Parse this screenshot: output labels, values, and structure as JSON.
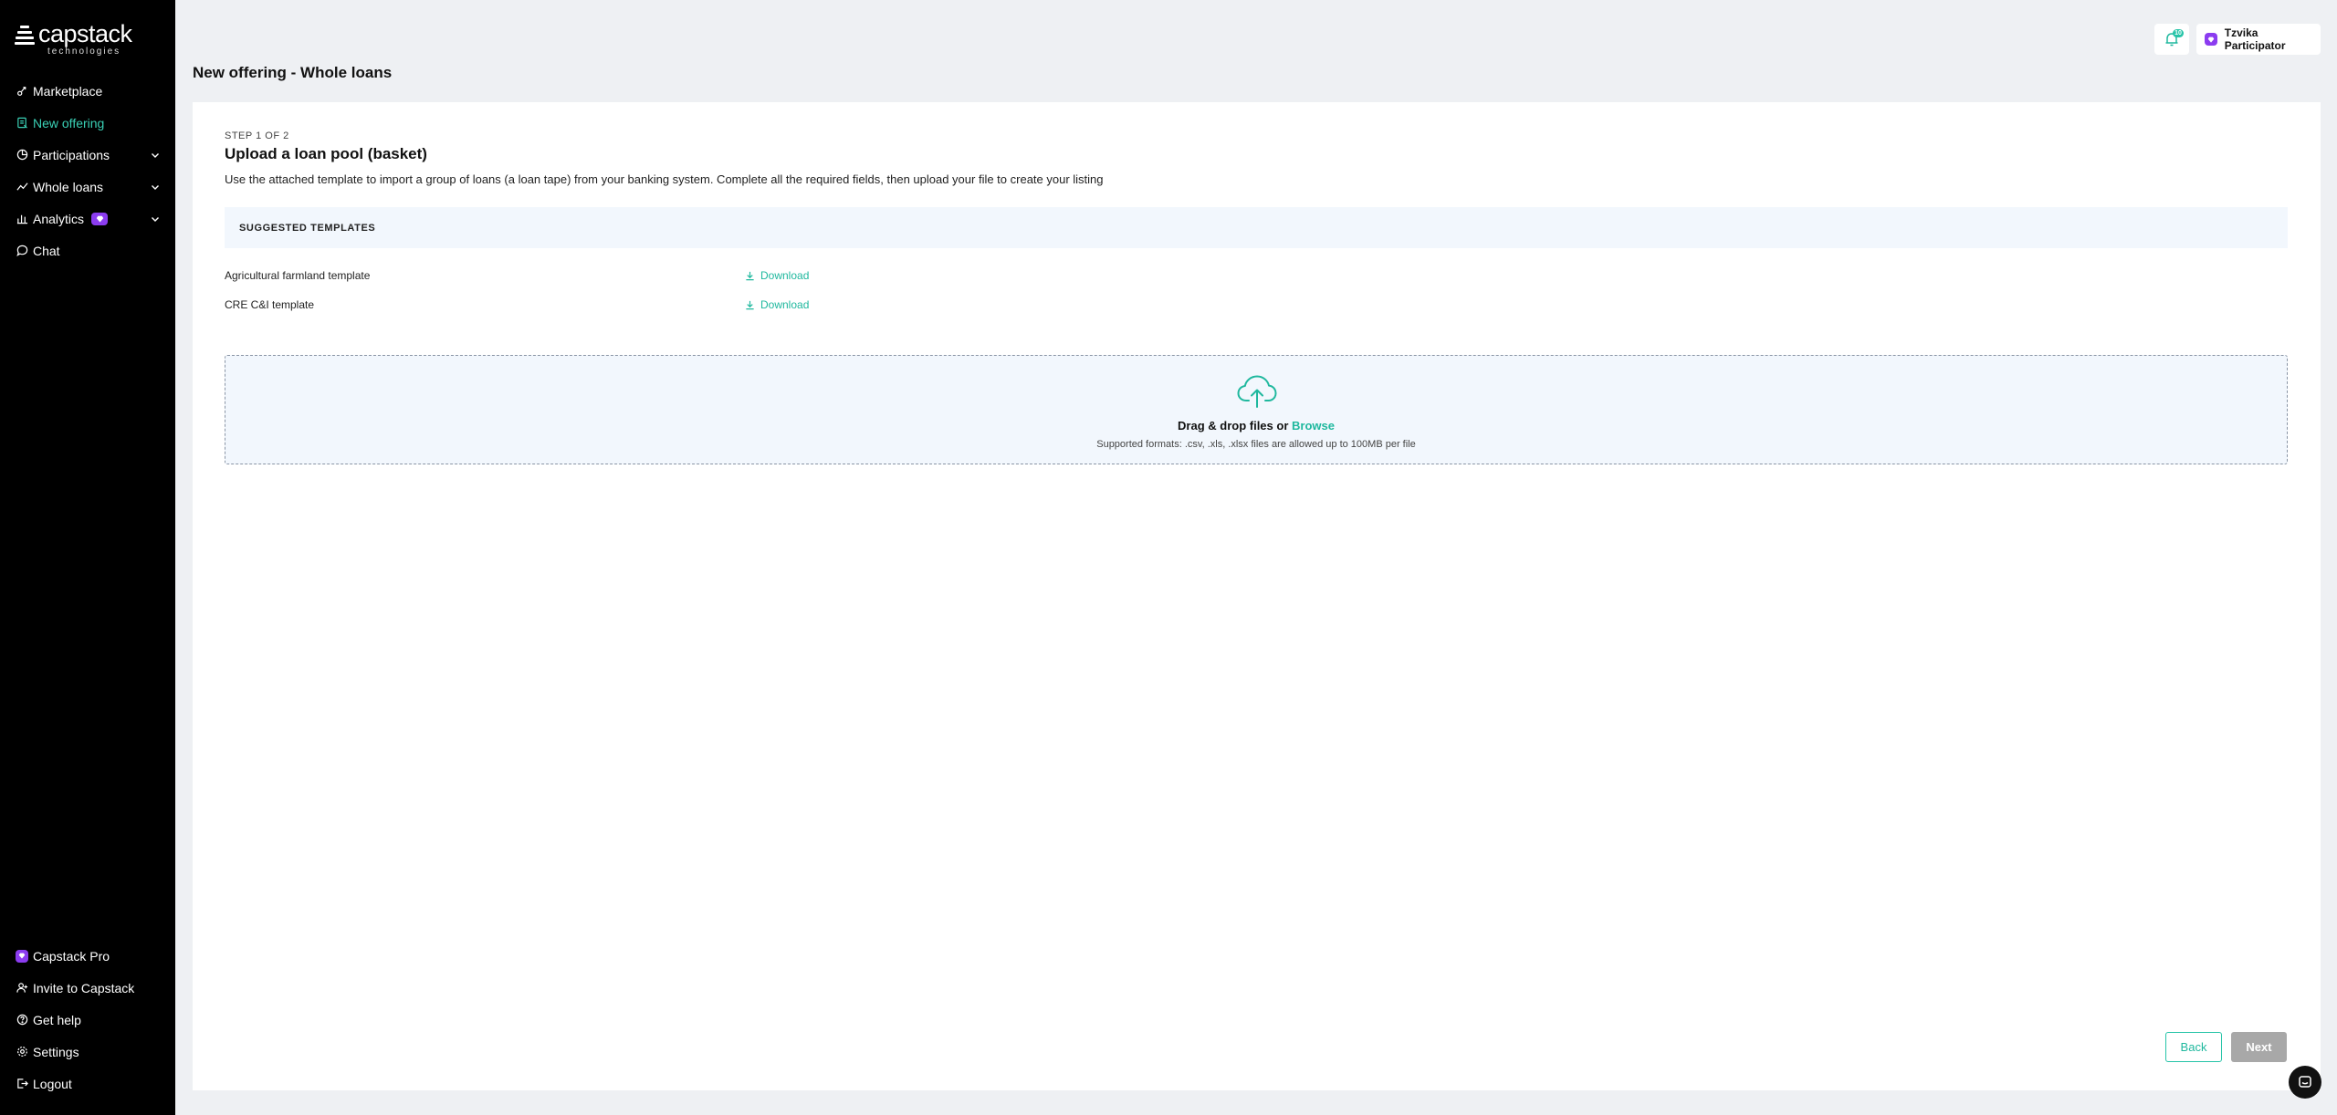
{
  "brand": {
    "name": "capstack",
    "sub": "technologies"
  },
  "sidebar": {
    "items": [
      {
        "label": "Marketplace",
        "icon": "marketplace-icon"
      },
      {
        "label": "New offering",
        "icon": "new-offering-icon",
        "active": true
      },
      {
        "label": "Participations",
        "icon": "participations-icon",
        "expandable": true
      },
      {
        "label": "Whole loans",
        "icon": "whole-loans-icon",
        "expandable": true
      },
      {
        "label": "Analytics",
        "icon": "analytics-icon",
        "expandable": true,
        "pro": true
      },
      {
        "label": "Chat",
        "icon": "chat-icon"
      }
    ],
    "bottom_items": [
      {
        "label": "Capstack Pro",
        "icon": "pro-icon"
      },
      {
        "label": "Invite to Capstack",
        "icon": "invite-icon"
      },
      {
        "label": "Get help",
        "icon": "help-icon"
      },
      {
        "label": "Settings",
        "icon": "settings-icon"
      },
      {
        "label": "Logout",
        "icon": "logout-icon"
      }
    ]
  },
  "header": {
    "notification_count": "10",
    "user_name": "Tzvika Participator"
  },
  "page": {
    "title": "New offering - Whole loans"
  },
  "card": {
    "step": "STEP 1 OF 2",
    "heading": "Upload a loan pool (basket)",
    "description": "Use the attached template to import a group of loans (a loan tape) from your banking system. Complete all the required fields, then upload your file to create your listing",
    "templates_header": "SUGGESTED TEMPLATES",
    "templates": [
      {
        "name": "Agricultural farmland template",
        "action": "Download"
      },
      {
        "name": "CRE C&I template",
        "action": "Download"
      }
    ],
    "dropzone": {
      "main_prefix": "Drag & drop files or ",
      "browse": "Browse",
      "supported": "Supported formats: .csv, .xls, .xlsx files are allowed up to 100MB per file"
    },
    "back_label": "Back",
    "next_label": "Next"
  },
  "colors": {
    "accent": "#26c4a8",
    "pro": "#8b3cf0",
    "sidebar_bg": "#000000"
  }
}
